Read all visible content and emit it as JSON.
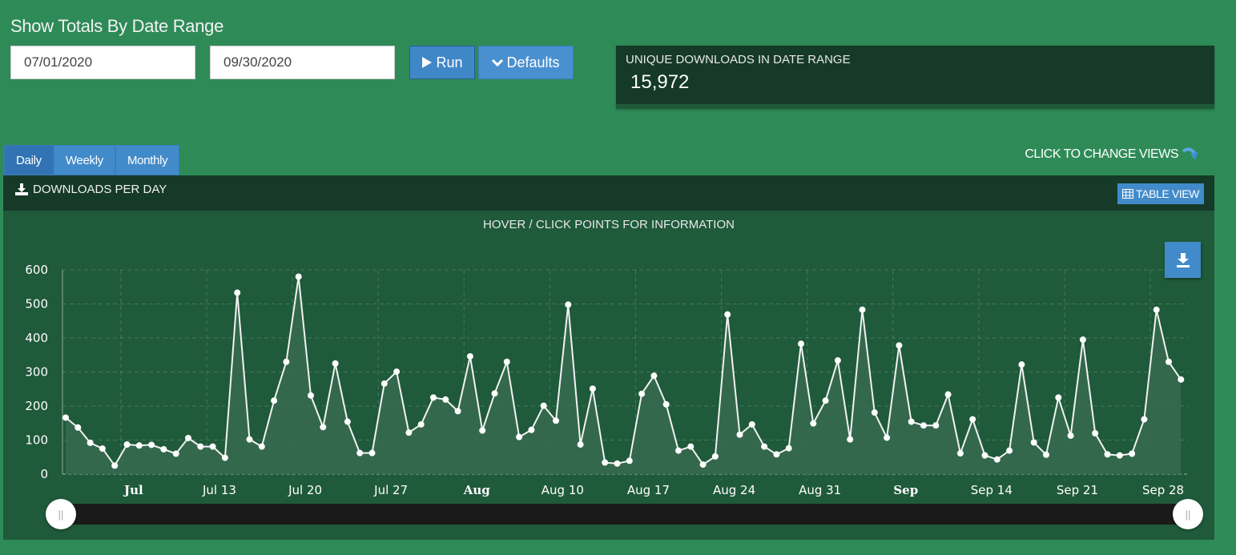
{
  "header": {
    "title": "Show Totals By Date Range"
  },
  "date_range": {
    "start": "07/01/2020",
    "end": "09/30/2020"
  },
  "buttons": {
    "run": "Run",
    "defaults": "Defaults",
    "table_view": "TABLE VIEW"
  },
  "icons": {
    "run": "play-icon",
    "defaults": "chevron-down-icon",
    "download": "download-icon",
    "table": "table-icon",
    "arrow": "curved-arrow-icon",
    "export": "export-download-icon",
    "handle": "grip-icon"
  },
  "stat": {
    "label": "UNIQUE DOWNLOADS IN DATE RANGE",
    "value": "15,972"
  },
  "tabs": [
    {
      "label": "Daily",
      "active": true
    },
    {
      "label": "Weekly",
      "active": false
    },
    {
      "label": "Monthly",
      "active": false
    }
  ],
  "change_views_hint": "CLICK TO CHANGE VIEWS",
  "panel": {
    "title": "DOWNLOADS PER DAY",
    "hint": "HOVER / CLICK POINTS FOR INFORMATION"
  },
  "colors": {
    "page_bg": "#2e8b57",
    "panel_bg": "#1f5a3a",
    "panel_header": "#153a27",
    "accent": "#428bca",
    "line": "#f2f2f2",
    "area_fill": "#35694f"
  },
  "chart_data": {
    "type": "area",
    "title": "DOWNLOADS PER DAY",
    "xlabel": "",
    "ylabel": "",
    "ylim": [
      0,
      600
    ],
    "yticks": [
      0,
      100,
      200,
      300,
      400,
      500,
      600
    ],
    "grid": true,
    "legend": "none",
    "x_start": "2020-07-01",
    "x_end": "2020-09-30",
    "x_tick_labels": [
      {
        "label": "Jul",
        "date": "2020-07-06",
        "bold": true
      },
      {
        "label": "Jul 13",
        "date": "2020-07-13",
        "bold": false
      },
      {
        "label": "Jul 20",
        "date": "2020-07-20",
        "bold": false
      },
      {
        "label": "Jul 27",
        "date": "2020-07-27",
        "bold": false
      },
      {
        "label": "Aug",
        "date": "2020-08-03",
        "bold": true
      },
      {
        "label": "Aug 10",
        "date": "2020-08-10",
        "bold": false
      },
      {
        "label": "Aug 17",
        "date": "2020-08-17",
        "bold": false
      },
      {
        "label": "Aug 24",
        "date": "2020-08-24",
        "bold": false
      },
      {
        "label": "Aug 31",
        "date": "2020-08-31",
        "bold": false
      },
      {
        "label": "Sep",
        "date": "2020-09-07",
        "bold": true
      },
      {
        "label": "Sep 14",
        "date": "2020-09-14",
        "bold": false
      },
      {
        "label": "Sep 21",
        "date": "2020-09-21",
        "bold": false
      },
      {
        "label": "Sep 28",
        "date": "2020-09-28",
        "bold": false
      }
    ],
    "series": [
      {
        "name": "Downloads",
        "values": [
          166,
          137,
          92,
          75,
          25,
          87,
          84,
          86,
          73,
          60,
          106,
          81,
          81,
          48,
          533,
          102,
          81,
          216,
          330,
          580,
          231,
          138,
          325,
          154,
          62,
          62,
          266,
          301,
          122,
          146,
          225,
          219,
          185,
          346,
          128,
          237,
          330,
          109,
          130,
          201,
          157,
          498,
          87,
          251,
          34,
          31,
          39,
          236,
          289,
          205,
          69,
          81,
          28,
          52,
          469,
          116,
          146,
          81,
          58,
          76,
          383,
          149,
          216,
          334,
          102,
          483,
          181,
          107,
          378,
          154,
          143,
          143,
          234,
          61,
          161,
          55,
          43,
          69,
          322,
          93,
          57,
          225,
          113,
          395,
          120,
          58,
          55,
          60,
          161,
          483,
          330,
          278
        ]
      }
    ],
    "range_slider": {
      "start": "2020-07-01",
      "end": "2020-09-30"
    }
  }
}
